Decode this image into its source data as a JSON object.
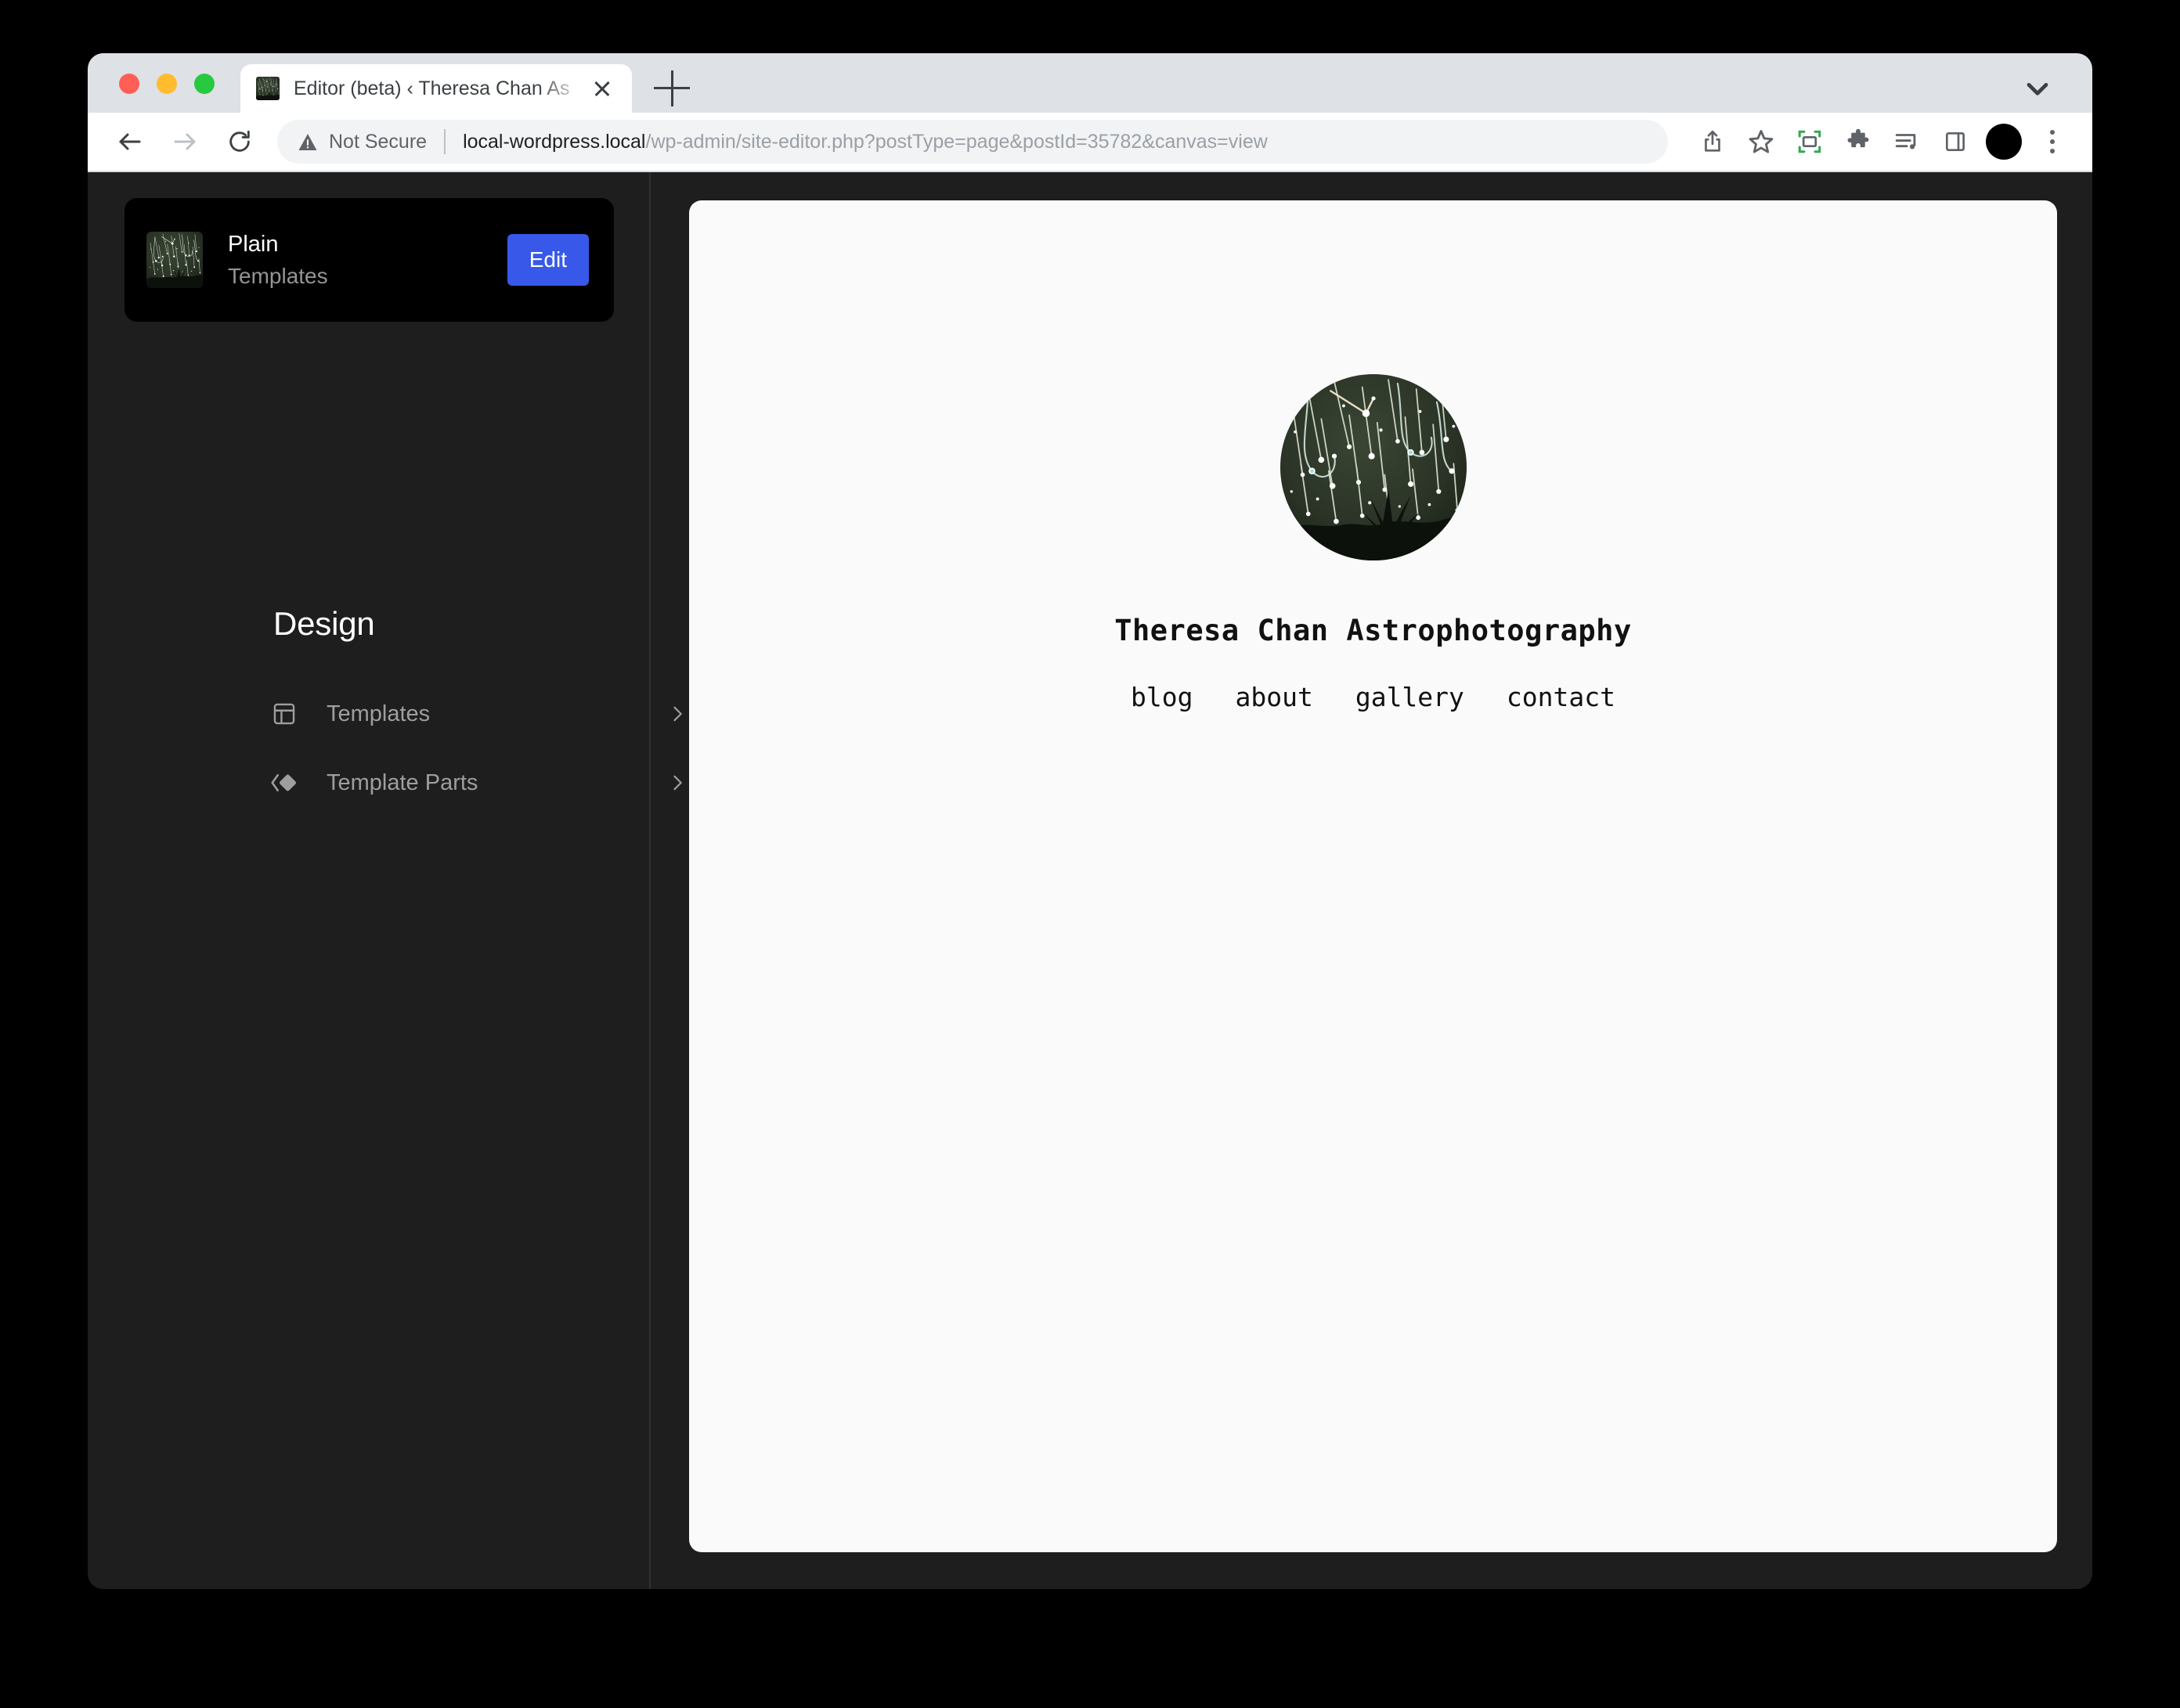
{
  "browser": {
    "traffic_lights": [
      "close",
      "minimize",
      "maximize"
    ],
    "tab": {
      "title": "Editor (beta) ‹ Theresa Chan As",
      "favicon_name": "star-trails-favicon",
      "close_label": "×"
    },
    "new_tab_label": "+",
    "tab_search_icon": "chevron-down-icon",
    "nav": {
      "back_icon": "back-arrow-icon",
      "forward_icon": "forward-arrow-icon",
      "reload_icon": "reload-icon"
    },
    "omnibox": {
      "security_icon": "warning-triangle-icon",
      "security_label": "Not Secure",
      "url_host": "local-wordpress.local",
      "url_path": "/wp-admin/site-editor.php?postType=page&postId=35782&canvas=view"
    },
    "toolbar_icons": [
      "share-icon",
      "bookmark-star-icon",
      "screen-capture-icon",
      "extensions-puzzle-icon",
      "media-playlist-icon",
      "side-panel-icon",
      "profile-avatar-icon",
      "three-dot-menu-icon"
    ]
  },
  "sidebar": {
    "site_card": {
      "thumbnail_name": "site-thumbnail",
      "title": "Plain",
      "subtitle": "Templates",
      "edit_label": "Edit"
    },
    "heading": "Design",
    "items": [
      {
        "label": "Templates",
        "icon": "layout-icon",
        "chevron": "chevron-right-icon"
      },
      {
        "label": "Template Parts",
        "icon": "symbol-filled-icon",
        "chevron": "chevron-right-icon"
      }
    ]
  },
  "canvas": {
    "logo_name": "site-logo-star-trails",
    "site_title": "Theresa Chan Astrophotography",
    "nav_items": [
      "blog",
      "about",
      "gallery",
      "contact"
    ]
  },
  "colors": {
    "page_background": "#000000",
    "window_chrome": "#1e1e1e",
    "tab_strip": "#dee1e6",
    "accent_blue": "#3858e9",
    "canvas_background": "#fafafa",
    "card_background": "#000000",
    "sidebar_text_muted": "#9e9e9e"
  }
}
